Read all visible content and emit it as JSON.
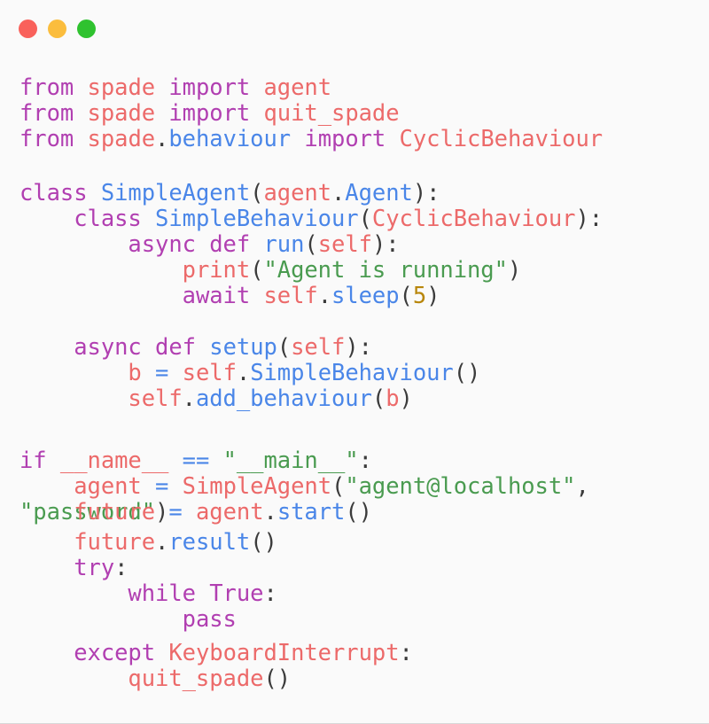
{
  "window": {
    "background_color": "#fafafa",
    "controls": [
      {
        "name": "close",
        "color": "#f9615b"
      },
      {
        "name": "minimize",
        "color": "#fbbd3d"
      },
      {
        "name": "maximize",
        "color": "#2fc22f"
      }
    ]
  },
  "theme": {
    "keyword_color": "#b13fb1",
    "name_color": "#ec6a6a",
    "function_color": "#4a86e8",
    "string_color": "#4a9b50",
    "number_color": "#b8860b",
    "operator_color": "#4a86e8",
    "punctuation_color": "#3b3b3b"
  },
  "code": {
    "language": "python",
    "lines": [
      "from spade import agent",
      "from spade import quit_spade",
      "from spade.behaviour import CyclicBehaviour",
      "",
      "class SimpleAgent(agent.Agent):",
      "    class SimpleBehaviour(CyclicBehaviour):",
      "        async def run(self):",
      "            print(\"Agent is running\")",
      "            await self.sleep(5)",
      "",
      "    async def setup(self):",
      "        b = self.SimpleBehaviour()",
      "        self.add_behaviour(b)",
      "",
      "if __name__ == \"__main__\":",
      "    agent = SimpleAgent(\"agent@localhost\",",
      "\"password\")",
      "    future = agent.start()",
      "    future.result()",
      "    try:",
      "        while True:",
      "            pass",
      "    except KeyboardInterrupt:",
      "        quit_spade()"
    ],
    "tokens": {
      "l1": {
        "kw1": "from",
        "mod": "spade",
        "kw2": "import",
        "name": "agent"
      },
      "l2": {
        "kw1": "from",
        "mod": "spade",
        "kw2": "import",
        "name": "quit_spade"
      },
      "l3": {
        "kw1": "from",
        "mod": "spade",
        "dot": ".",
        "sub": "behaviour",
        "kw2": "import",
        "name": "CyclicBehaviour"
      },
      "l5": {
        "kw": "class",
        "cls": "SimpleAgent",
        "open": "(",
        "mod": "agent",
        "dot": ".",
        "base": "Agent",
        "close": ")",
        "colon": ":"
      },
      "l6": {
        "indent": "    ",
        "kw": "class",
        "cls": "SimpleBehaviour",
        "open": "(",
        "base": "CyclicBehaviour",
        "close": ")",
        "colon": ":"
      },
      "l7": {
        "indent": "        ",
        "kw1": "async",
        "kw2": "def",
        "fn": "run",
        "open": "(",
        "arg": "self",
        "close": ")",
        "colon": ":"
      },
      "l8": {
        "indent": "            ",
        "fn": "print",
        "open": "(",
        "str": "\"Agent is running\"",
        "close": ")"
      },
      "l9": {
        "indent": "            ",
        "kw": "await",
        "obj": "self",
        "dot": ".",
        "fn": "sleep",
        "open": "(",
        "num": "5",
        "close": ")"
      },
      "l11": {
        "indent": "    ",
        "kw1": "async",
        "kw2": "def",
        "fn": "setup",
        "open": "(",
        "arg": "self",
        "close": ")",
        "colon": ":"
      },
      "l12": {
        "indent": "        ",
        "var": "b",
        "op": "=",
        "obj": "self",
        "dot": ".",
        "fn": "SimpleBehaviour",
        "parens": "()"
      },
      "l13": {
        "indent": "        ",
        "obj": "self",
        "dot": ".",
        "fn": "add_behaviour",
        "open": "(",
        "arg": "b",
        "close": ")"
      },
      "l15": {
        "kw": "if",
        "name": "__name__",
        "op": "==",
        "str": "\"__main__\"",
        "colon": ":"
      },
      "l16": {
        "indent": "    ",
        "var": "agent",
        "op": "=",
        "fn": "SimpleAgent",
        "open": "(",
        "str": "\"agent@localhost\"",
        "comma": ","
      },
      "l17": {
        "str": "\"password\"",
        "close": ")"
      },
      "l18": {
        "indent": "    ",
        "var": "future",
        "op": "=",
        "obj": "agent",
        "dot": ".",
        "fn": "start",
        "parens": "()"
      },
      "l19": {
        "indent": "    ",
        "obj": "future",
        "dot": ".",
        "fn": "result",
        "parens": "()"
      },
      "l20": {
        "indent": "    ",
        "kw": "try",
        "colon": ":"
      },
      "l21": {
        "indent": "        ",
        "kw1": "while",
        "kw2": "True",
        "colon": ":"
      },
      "l22": {
        "indent": "            ",
        "kw": "pass"
      },
      "l23": {
        "indent": "    ",
        "kw": "except",
        "exc": "KeyboardInterrupt",
        "colon": ":"
      },
      "l24": {
        "indent": "        ",
        "fn": "quit_spade",
        "parens": "()"
      }
    }
  }
}
